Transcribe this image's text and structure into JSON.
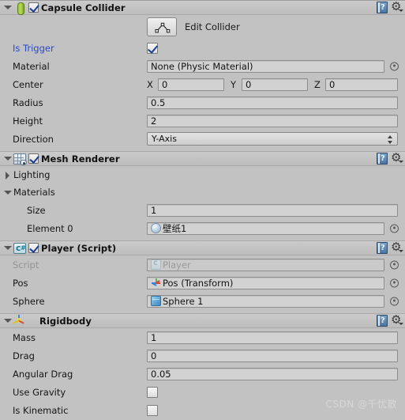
{
  "components": [
    {
      "name": "capsule-collider",
      "title": "Capsule Collider",
      "icon": "capsule-collider-icon",
      "enabled": true,
      "has_checkbox": true,
      "expanded": true,
      "edit_button": {
        "label": "Edit Collider",
        "icon": "edit-collider-icon"
      },
      "fields": [
        {
          "label": "Is Trigger",
          "type": "checkbox",
          "value": true,
          "label_color": "#2b49c8"
        },
        {
          "label": "Material",
          "type": "object",
          "value": "None (Physic Material)",
          "icon": "none"
        },
        {
          "label": "Center",
          "type": "vector3",
          "x": "0",
          "y": "0",
          "z": "0",
          "axis_labels": [
            "X",
            "Y",
            "Z"
          ]
        },
        {
          "label": "Radius",
          "type": "text",
          "value": "0.5"
        },
        {
          "label": "Height",
          "type": "text",
          "value": "2"
        },
        {
          "label": "Direction",
          "type": "dropdown",
          "value": "Y-Axis"
        }
      ]
    },
    {
      "name": "mesh-renderer",
      "title": "Mesh Renderer",
      "icon": "mesh-renderer-icon",
      "enabled": true,
      "has_checkbox": true,
      "expanded": true,
      "foldouts": [
        {
          "label": "Lighting",
          "expanded": false
        },
        {
          "label": "Materials",
          "expanded": true
        }
      ],
      "fields": [
        {
          "label": "Size",
          "type": "text",
          "value": "1",
          "indent": 2
        },
        {
          "label": "Element 0",
          "type": "object",
          "value": "壁纸1",
          "icon": "sphere",
          "indent": 2
        }
      ]
    },
    {
      "name": "player-script",
      "title": "Player (Script)",
      "icon": "csharp-script-icon",
      "enabled": true,
      "has_checkbox": true,
      "expanded": true,
      "fields": [
        {
          "label": "Script",
          "type": "object",
          "value": "Player",
          "icon": "script",
          "disabled": true
        },
        {
          "label": "Pos",
          "type": "object",
          "value": "Pos (Transform)",
          "icon": "transform"
        },
        {
          "label": "Sphere",
          "type": "object",
          "value": "Sphere 1",
          "icon": "cube"
        }
      ]
    },
    {
      "name": "rigidbody",
      "title": "Rigidbody",
      "icon": "rigidbody-icon",
      "enabled": true,
      "has_checkbox": false,
      "expanded": true,
      "fields": [
        {
          "label": "Mass",
          "type": "text",
          "value": "1"
        },
        {
          "label": "Drag",
          "type": "text",
          "value": "0"
        },
        {
          "label": "Angular Drag",
          "type": "text",
          "value": "0.05"
        },
        {
          "label": "Use Gravity",
          "type": "checkbox",
          "value": false
        },
        {
          "label": "Is Kinematic",
          "type": "checkbox",
          "value": false
        }
      ]
    }
  ],
  "header_buttons": {
    "help": "help-icon",
    "settings": "gear-icon"
  },
  "watermark": "CSDN @千忧散",
  "colors": {
    "panel_bg": "#c2c2c2",
    "header_bg": "#c6c6c6",
    "field_bg": "#d2d2d2",
    "override_label": "#2b49c8",
    "checkmark": "#1c3f8f"
  }
}
